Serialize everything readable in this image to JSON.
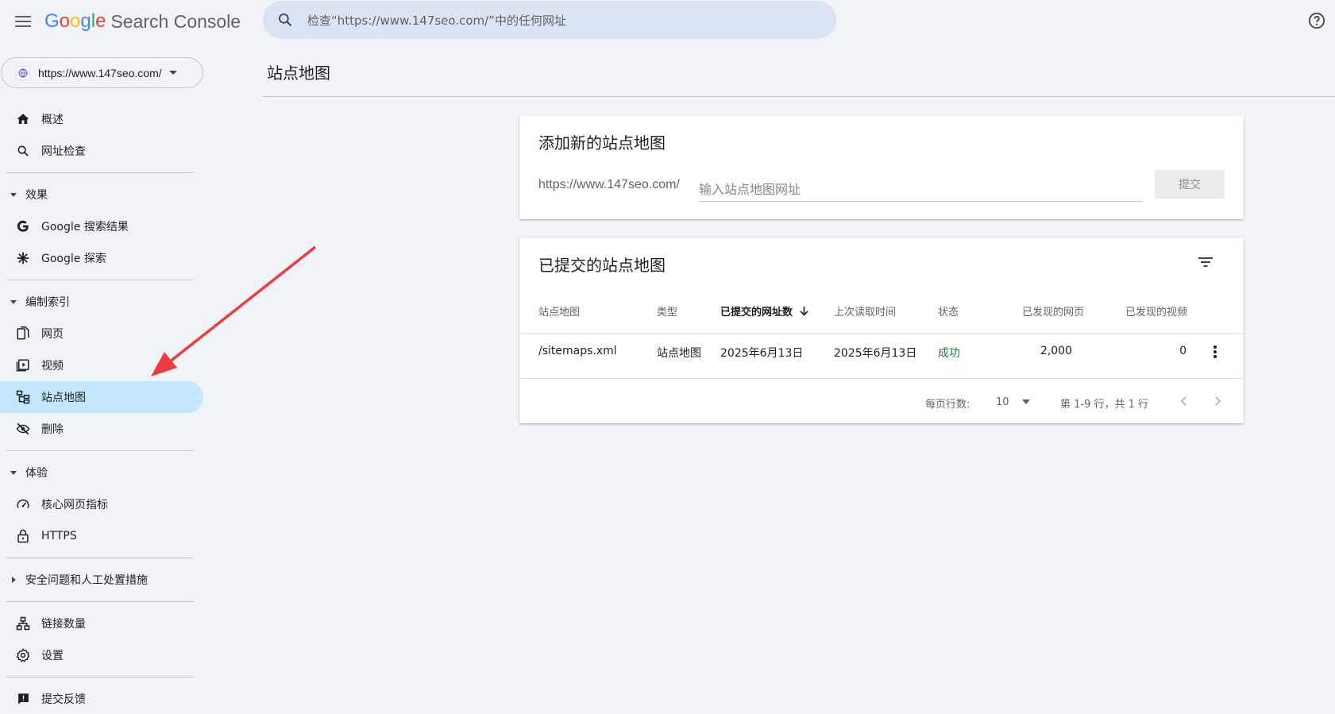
{
  "header": {
    "logo_google": [
      "G",
      "o",
      "o",
      "g",
      "l",
      "e"
    ],
    "logo_product": "Search Console",
    "search_placeholder": "检查“https://www.147seo.com/”中的任何网址"
  },
  "property": {
    "url": "https://www.147seo.com/"
  },
  "sidebar": {
    "top_items": [
      {
        "label": "概述",
        "icon": "home-icon"
      },
      {
        "label": "网址检查",
        "icon": "search-icon"
      }
    ],
    "sections": [
      {
        "title": "效果",
        "items": [
          {
            "label": "Google 搜索结果",
            "icon": "google-g-icon"
          },
          {
            "label": "Google 探索",
            "icon": "asterisk-icon"
          }
        ]
      },
      {
        "title": "编制索引",
        "items": [
          {
            "label": "网页",
            "icon": "pages-icon"
          },
          {
            "label": "视频",
            "icon": "video-icon"
          },
          {
            "label": "站点地图",
            "icon": "sitemap-icon",
            "active": true
          },
          {
            "label": "删除",
            "icon": "eye-off-icon"
          }
        ]
      },
      {
        "title": "体验",
        "items": [
          {
            "label": "核心网页指标",
            "icon": "speed-icon"
          },
          {
            "label": "HTTPS",
            "icon": "lock-icon"
          }
        ]
      }
    ],
    "security_section": "安全问题和人工处置措施",
    "bottom_items": [
      {
        "label": "链接数量",
        "icon": "links-icon"
      },
      {
        "label": "设置",
        "icon": "gear-icon"
      }
    ],
    "feedback": {
      "label": "提交反馈",
      "icon": "feedback-icon"
    }
  },
  "page": {
    "title": "站点地图"
  },
  "add_card": {
    "title": "添加新的站点地图",
    "prefix": "https://www.147seo.com/",
    "input_placeholder": "输入站点地图网址",
    "submit_label": "提交"
  },
  "submitted_card": {
    "title": "已提交的站点地图",
    "columns": [
      "站点地图",
      "类型",
      "已提交的网址数",
      "上次读取时间",
      "状态",
      "已发现的网页",
      "已发现的视频"
    ],
    "rows": [
      {
        "sitemap": "/sitemaps.xml",
        "type": "站点地图",
        "submitted": "2025年6月13日",
        "last_read": "2025年6月13日",
        "status": "成功",
        "pages": "2,000",
        "videos": "0"
      }
    ],
    "rows_per_page_label": "每页行数:",
    "rows_per_page": "10",
    "range_label": "第 1-9 行，共 1 行"
  },
  "colors": {
    "active_nav": "#c2e7ff",
    "success": "#188038",
    "annotation_arrow": "#ee3b3b"
  }
}
